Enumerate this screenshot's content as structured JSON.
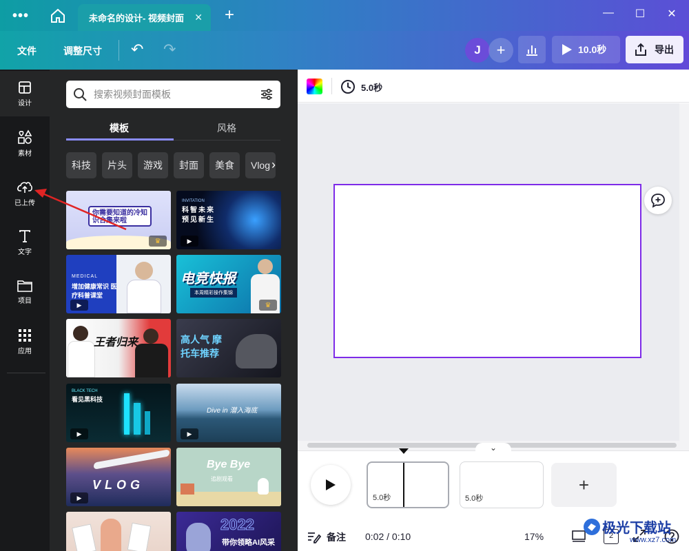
{
  "titlebar": {
    "tab_title": "未命名的设计- 视频封面",
    "tab_close": "✕",
    "new_tab": "+",
    "more": "•••"
  },
  "toolbar": {
    "file_label": "文件",
    "resize_label": "调整尺寸",
    "avatar_letter": "J",
    "add_member": "+",
    "play_duration": "10.0秒",
    "export_label": "导出"
  },
  "rail": {
    "items": [
      {
        "label": "设计",
        "icon": "layout-icon"
      },
      {
        "label": "素材",
        "icon": "elements-icon"
      },
      {
        "label": "已上传",
        "icon": "cloud-upload-icon"
      },
      {
        "label": "文字",
        "icon": "text-icon"
      },
      {
        "label": "项目",
        "icon": "folder-icon"
      },
      {
        "label": "应用",
        "icon": "apps-grid-icon"
      }
    ]
  },
  "panel": {
    "search_placeholder": "搜索视频封面模板",
    "tabs": [
      {
        "label": "模板"
      },
      {
        "label": "风格"
      }
    ],
    "chips": [
      "科技",
      "片头",
      "游戏",
      "封面",
      "美食",
      "Vlog"
    ],
    "thumbnails": [
      {
        "title": "你需要知道的冷知识合集来啦",
        "bg": "#dfe0f7",
        "fg": "#3a2fa0",
        "video": false,
        "premium": true
      },
      {
        "title": "科智未来 预见新生",
        "bg": "#0a1330",
        "fg": "#ffffff",
        "video": true,
        "premium": false,
        "subtitle": "INVITATION"
      },
      {
        "title": "增加健康常识 医疗科普课堂",
        "bg": "#1f3fbf",
        "fg": "#ffffff",
        "video": true,
        "premium": false,
        "subtitle": "MEDICAL"
      },
      {
        "title": "电竞快报",
        "bg": "#16a6c8",
        "fg": "#ffffff",
        "video": false,
        "premium": true,
        "subtitle": "本周精彩操作集锦"
      },
      {
        "title": "王者归来",
        "bg": "#f2f2f2",
        "fg": "#111111",
        "video": false,
        "premium": false
      },
      {
        "title": "高人气 摩托车推荐",
        "bg": "#1e1f2b",
        "fg": "#6fd3ff",
        "video": false,
        "premium": false
      },
      {
        "title": "看见黑科技",
        "bg": "#031318",
        "fg": "#ffffff",
        "video": true,
        "premium": false,
        "subtitle": "BLACK TECH"
      },
      {
        "title": "Dive in 潜入海底",
        "bg": "#3d6b8c",
        "fg": "#ffffff",
        "video": true,
        "premium": false
      },
      {
        "title": "VLOG",
        "bg": "#2a3f7a",
        "fg": "#ffffff",
        "video": true,
        "premium": false
      },
      {
        "title": "Bye Bye",
        "bg": "#b8d6c8",
        "fg": "#ffffff",
        "video": false,
        "premium": false,
        "subtitle": "追剧观看"
      },
      {
        "title": "",
        "bg": "#e9d7cf",
        "fg": "#333333",
        "video": false,
        "premium": false
      },
      {
        "title": "带你领略AI风采",
        "bg": "#2b1f6e",
        "fg": "#ffffff",
        "video": false,
        "premium": false,
        "subtitle": "2022"
      }
    ]
  },
  "canvas": {
    "duration": "5.0秒"
  },
  "timeline": {
    "clips": [
      {
        "duration": "5.0秒"
      },
      {
        "duration": "5.0秒"
      }
    ],
    "add": "+"
  },
  "bottom": {
    "notes_label": "备注",
    "time_readout": "0:02 / 0:10",
    "zoom": "17%",
    "page_count": "2"
  },
  "watermark": {
    "text": "极光下载站",
    "url": "www.xz7.com"
  },
  "colors": {
    "accent": "#7d2ae8",
    "panel_bg": "#252627",
    "rail_bg": "#18191b",
    "annotation_arrow": "#e02424"
  }
}
